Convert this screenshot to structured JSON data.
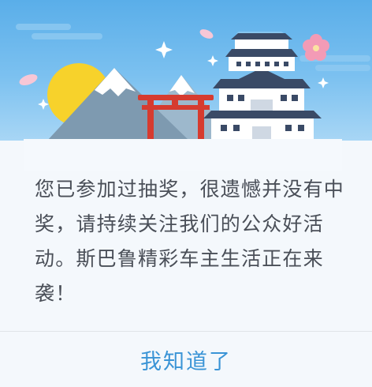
{
  "dialog": {
    "message": "您已参加过抽奖，很遗憾并没有中奖，请持续关注我们的公众好活动。斯巴鲁精彩车主生活正在来袭！",
    "confirm_label": "我知道了"
  },
  "banner": {
    "sky_color": "#5aaee9",
    "sun_color": "#f7d22b",
    "torii_color": "#d63b2f",
    "castle_roof_color": "#3a4a66"
  },
  "colors": {
    "text": "#4a4f58",
    "accent": "#3a94d6",
    "divider": "#dfe3e8"
  }
}
